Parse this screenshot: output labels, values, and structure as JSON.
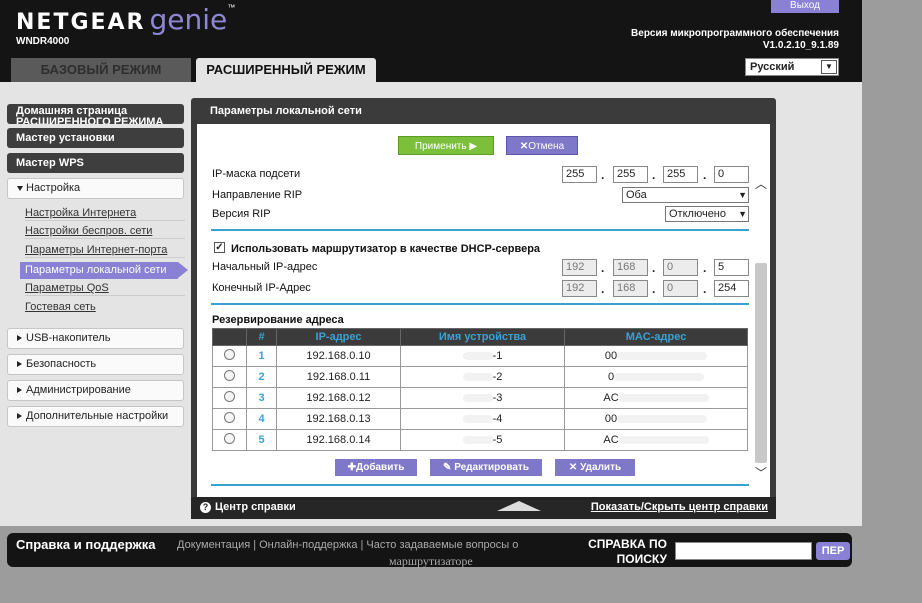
{
  "header": {
    "brand_netgear": "NETGEAR",
    "brand_genie": "genie",
    "model": "WNDR4000",
    "logout": "Выход",
    "firmware_label": "Версия микропрограммного обеспечения",
    "firmware_version": "V1.0.2.10_9.1.89",
    "tab_basic": "БАЗОВЫЙ РЕЖИМ",
    "tab_advanced": "РАСШИРЕННЫЙ РЕЖИМ",
    "language": "Русский"
  },
  "sidebar": {
    "home": "Домашняя страница РАСШИРЕННОГО РЕЖИМА",
    "setup_wizard": "Мастер установки",
    "wps_wizard": "Мастер WPS",
    "settings": "Настройка",
    "sub_items": [
      "Настройка Интернета",
      "Настройки беспров. сети",
      "Параметры Интернет-порта",
      "Параметры локальной сети",
      "Параметры QoS",
      "Гостевая сеть"
    ],
    "usb": "USB-накопитель",
    "security": "Безопасность",
    "admin": "Администрирование",
    "advanced": "Дополнительные настройки"
  },
  "panel": {
    "title": "Параметры локальной сети",
    "apply": "Применить ▶",
    "cancel": "Отмена",
    "subnet_label": "IP-маска подсети",
    "subnet": [
      "255",
      "255",
      "255",
      "0"
    ],
    "rip_dir_label": "Направление RIP",
    "rip_dir": "Оба",
    "rip_ver_label": "Версия RIP",
    "rip_ver": "Отключено",
    "dhcp_label": "Использовать маршрутизатор в качестве DHCP-сервера",
    "start_ip_label": "Начальный IP-адрес",
    "start_ip": [
      "192",
      "168",
      "0",
      "5"
    ],
    "end_ip_label": "Конечный IP-Адрес",
    "end_ip": [
      "192",
      "168",
      "0",
      "254"
    ],
    "reservation_label": "Резервирование адреса",
    "table_headers": [
      "#",
      "IP-адрес",
      "Имя устройства",
      "MAC-адрес"
    ],
    "rows": [
      {
        "num": "1",
        "ip": "192.168.0.10",
        "name": "-1",
        "mac": "00"
      },
      {
        "num": "2",
        "ip": "192.168.0.11",
        "name": "-2",
        "mac": "0"
      },
      {
        "num": "3",
        "ip": "192.168.0.12",
        "name": "-3",
        "mac": "AC"
      },
      {
        "num": "4",
        "ip": "192.168.0.13",
        "name": "-4",
        "mac": "00"
      },
      {
        "num": "5",
        "ip": "192.168.0.14",
        "name": "-5",
        "mac": "AC"
      }
    ],
    "add": "Добавить",
    "edit": "Редактировать",
    "delete": "Удалить",
    "help_center": "Центр справки",
    "toggle_help": "Показать/Скрыть центр справки"
  },
  "bottom": {
    "title": "Справка и поддержка",
    "links": [
      "Документация",
      "Онлайн-поддержка",
      "Часто задаваемые вопросы о"
    ],
    "links_sub": "маршрутизаторе",
    "search_label": "СПРАВКА ПО ПОИСКУ",
    "search_button": "ПЕР"
  }
}
